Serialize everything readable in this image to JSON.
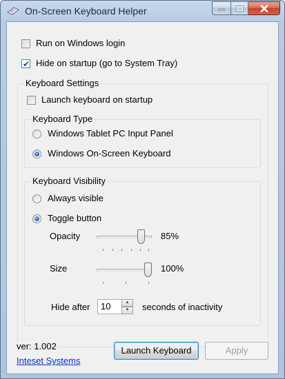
{
  "window": {
    "title": "On-Screen Keyboard Helper"
  },
  "options": {
    "run_on_login": {
      "label": "Run on Windows login",
      "checked": false
    },
    "hide_on_startup": {
      "label": "Hide on startup (go to System Tray)",
      "checked": true
    }
  },
  "keyboard_settings": {
    "legend": "Keyboard Settings",
    "launch_on_startup": {
      "label": "Launch keyboard on startup",
      "checked": false
    },
    "keyboard_type": {
      "legend": "Keyboard Type",
      "options": [
        {
          "label": "Windows Tablet PC Input Panel",
          "selected": false
        },
        {
          "label": "Windows On-Screen Keyboard",
          "selected": true
        }
      ]
    },
    "keyboard_visibility": {
      "legend": "Keyboard Visibility",
      "options": [
        {
          "label": "Always visible",
          "selected": false
        },
        {
          "label": "Toggle button",
          "selected": true
        }
      ],
      "opacity": {
        "label": "Opacity",
        "value_text": "85%",
        "value": 0.85
      },
      "size": {
        "label": "Size",
        "value_text": "100%",
        "value": 1.0
      },
      "hide_after": {
        "label": "Hide after",
        "value": "10",
        "suffix": "seconds of inactivity"
      }
    }
  },
  "footer": {
    "version": "ver: 1.002",
    "company_link": "Inteset Systems",
    "launch_button": "Launch Keyboard",
    "apply_button": "Apply"
  }
}
